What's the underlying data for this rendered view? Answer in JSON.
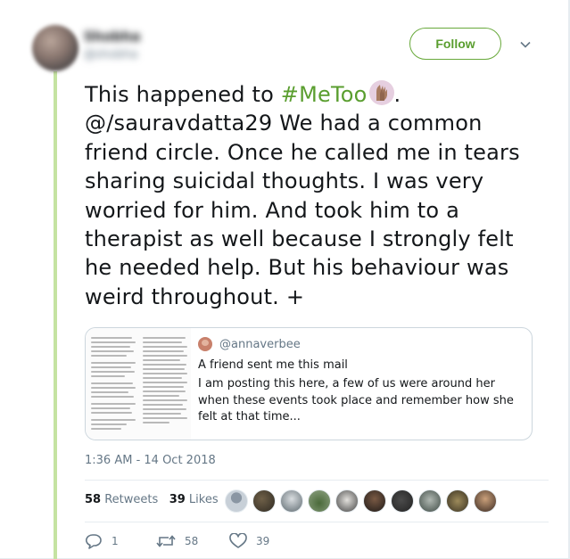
{
  "header": {
    "display_name": "Shobha",
    "handle": "@shobha",
    "follow_label": "Follow",
    "follow_color": "#5a9e2f"
  },
  "tweet": {
    "lines": [
      "@/sauravdatta29 We had a common",
      "friend circle. Once he called me in tears",
      "sharing suicidal thoughts. I was very",
      "worried for him. And took him to a",
      "therapist as well because I strongly felt",
      "he needed help. But his behaviour was",
      "weird throughout. +"
    ],
    "first_prefix": "This happened to ",
    "hashtag": "#MeToo",
    "first_suffix": ".",
    "emoji": "raised-hands-icon"
  },
  "quote": {
    "username": "@annaverbee",
    "line1": "A friend sent me this mail",
    "line2": "I am posting this here, a few of us were around her when these events took place and remember how she felt at that time..."
  },
  "meta": {
    "timestamp": "1:36 AM - 14 Oct 2018",
    "retweets_count": "58",
    "retweets_label": "Retweets",
    "likes_count": "39",
    "likes_label": "Likes"
  },
  "actions": {
    "reply_count": "1",
    "retweet_count": "58",
    "like_count": "39"
  },
  "colors": {
    "accent": "#5a9e2f",
    "muted": "#657786",
    "thread_line": "#c5e3a2"
  }
}
